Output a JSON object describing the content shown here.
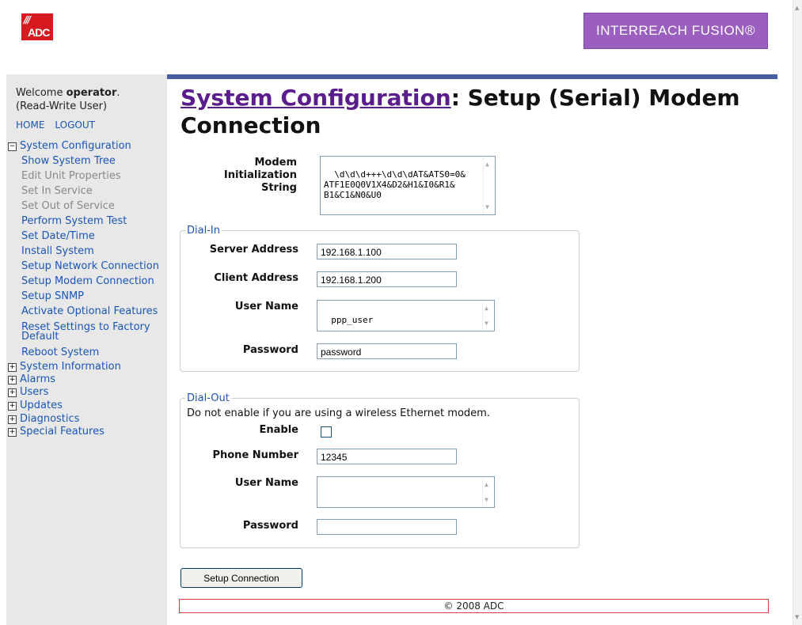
{
  "header": {
    "logo_text": "ADC",
    "brand_text": "INTERREACH FUSION®"
  },
  "sidebar": {
    "welcome_prefix": "Welcome ",
    "username": "operator",
    "welcome_suffix": ".",
    "role": "(Read-Write User)",
    "home": "HOME",
    "logout": "LOGOUT",
    "sys_config": "System Configuration",
    "items": [
      "Show System Tree",
      "Edit Unit Properties",
      "Set In Service",
      "Set Out of Service",
      "Perform System Test",
      "Set Date/Time",
      "Install System",
      "Setup Network Connection",
      "Setup Modem Connection",
      "Setup SNMP",
      "Activate Optional Features",
      "Reset Settings to Factory Default",
      "Reboot System"
    ],
    "sections": [
      "System Information",
      "Alarms",
      "Users",
      "Updates",
      "Diagnostics",
      "Special Features"
    ]
  },
  "page": {
    "title_link": "System Configuration",
    "title_rest": ": Setup (Serial) Modem Connection"
  },
  "form": {
    "init_label_1": "Modem Initialization",
    "init_label_2": "String",
    "init_value": "\\d\\d\\d+++\\d\\d\\dAT&ATS0=0&\nATF1E0Q0V1X4&D2&H1&I0&R1&\nB1&C1&N0&U0",
    "dialin": {
      "legend": "Dial-In",
      "server_label": "Server Address",
      "server_value": "192.168.1.100",
      "client_label": "Client Address",
      "client_value": "192.168.1.200",
      "user_label": "User Name",
      "user_value": "ppp_user",
      "pass_label": "Password",
      "pass_value": "password"
    },
    "dialout": {
      "legend": "Dial-Out",
      "note": "Do not enable if you are using a wireless Ethernet modem.",
      "enable_label": "Enable",
      "enable_checked": false,
      "phone_label": "Phone Number",
      "phone_value": "12345",
      "user_label": "User Name",
      "user_value": "",
      "pass_label": "Password",
      "pass_value": ""
    },
    "submit_label": "Setup Connection"
  },
  "footer": {
    "text": "© 2008 ADC"
  },
  "colors": {
    "brand_purple": "#9b5fc0",
    "logo_red": "#d71a20",
    "header_bar": "#465ea0",
    "link_blue": "#1a56b8",
    "title_link": "#5a1d8c"
  }
}
